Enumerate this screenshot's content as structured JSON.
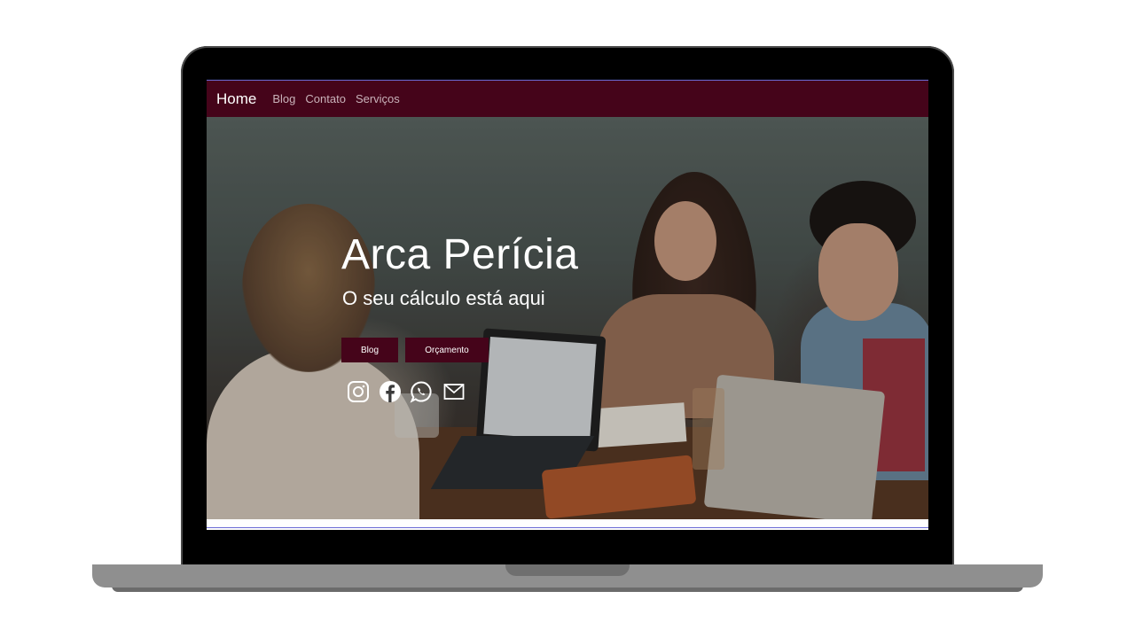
{
  "navbar": {
    "brand": "Home",
    "links": [
      "Blog",
      "Contato",
      "Serviços"
    ]
  },
  "hero": {
    "title": "Arca Perícia",
    "subtitle": "O seu cálculo está aqui",
    "buttons": {
      "blog": "Blog",
      "orcamento": "Orçamento"
    },
    "social_icons": [
      "instagram-icon",
      "facebook-icon",
      "whatsapp-icon",
      "email-icon"
    ]
  },
  "colors": {
    "brand": "#45041a",
    "nav_link": "#c9b2ba",
    "text_on_dark": "#ffffff"
  }
}
